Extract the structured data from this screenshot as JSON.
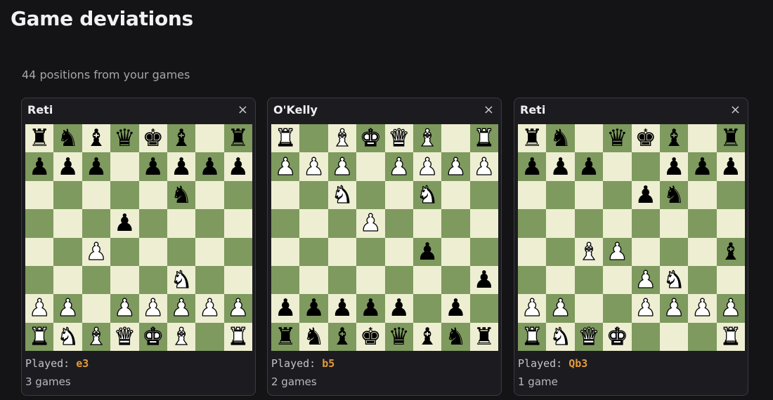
{
  "header": {
    "title": "Game deviations"
  },
  "summary": {
    "text": "44 positions from your games"
  },
  "played_label": "Played: ",
  "close_symbol": "×",
  "piece_glyphs": {
    "K": "♚",
    "Q": "♛",
    "R": "♜",
    "B": "♝",
    "N": "♞",
    "P": "♟",
    "k": "♚",
    "q": "♛",
    "r": "♜",
    "b": "♝",
    "n": "♞",
    "p": "♟"
  },
  "colors": {
    "board_light": "#eeeed2",
    "board_dark": "#7e9a5e",
    "move_accent": "#e39b3a",
    "background": "#141417"
  },
  "cards": [
    {
      "opening": "Reti",
      "played_move": "e3",
      "games": "3 games",
      "fen": "rnbqkb1r/ppp1pppp/5n2/3p4/2P5/5N2/PP1PPPPP/RNBQKB1R"
    },
    {
      "opening": "O'Kelly",
      "played_move": "b5",
      "games": "2 games",
      "fen": "R1BKQB1R/PPP1PPPP/2N2N2/3P4/5p2/7p/ppppp1p1/rnbkqbnr"
    },
    {
      "opening": "Reti",
      "played_move": "Qb3",
      "games": "1 game",
      "fen": "rn1qkb1r/ppp2ppp/4pn2/8/2BP3b/4PN2/PP2PPPP/RNQK3R"
    }
  ]
}
